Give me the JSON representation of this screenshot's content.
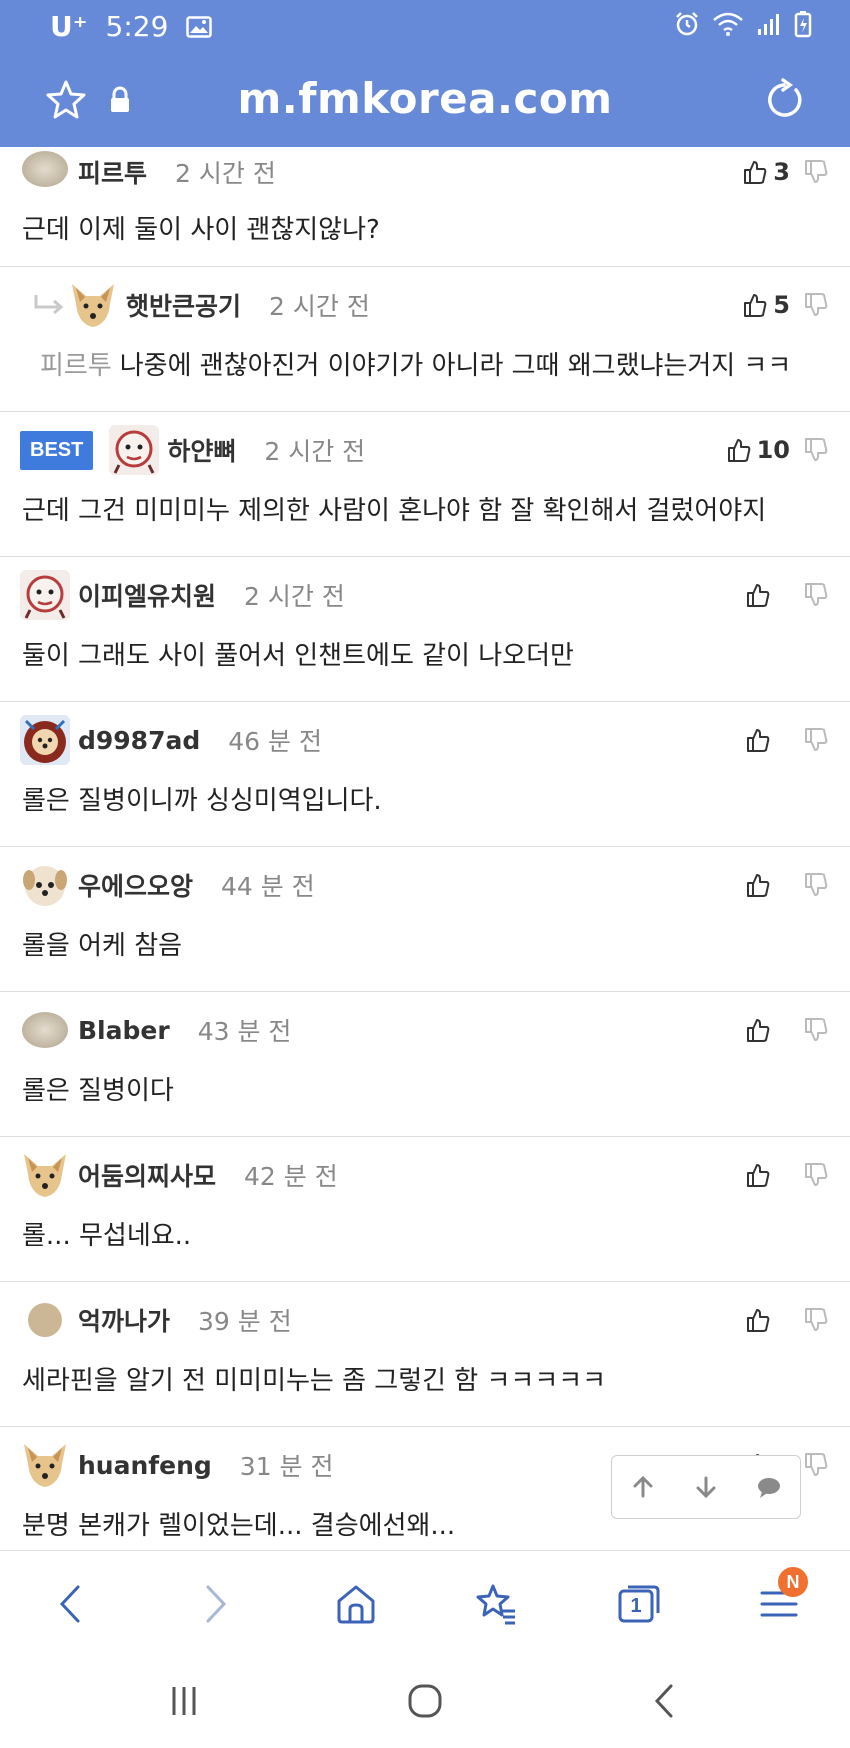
{
  "status_bar": {
    "carrier": "U⁺",
    "time": "5:29",
    "icons": [
      "image-icon",
      "alarm-icon",
      "wifi-icon",
      "signal-icon",
      "battery-icon"
    ]
  },
  "address_bar": {
    "url": "m.fmkorea.com",
    "icons": [
      "star-icon",
      "lock-icon",
      "reload-icon"
    ]
  },
  "colors": {
    "header_bg": "#6689d8",
    "best_badge": "#3f7bdd",
    "notification_badge": "#f07030"
  },
  "comments": [
    {
      "author": "피르투",
      "time": "2 시간 전",
      "up": "3",
      "text": "근데 이제 둘이 사이 괜찮지않나?",
      "avatar": "avatar-blur"
    },
    {
      "author": "햇반큰공기",
      "time": "2 시간 전",
      "up": "5",
      "reply_to": "피르투",
      "text": "나중에 괜찮아진거 이야기가 아니라 그때 왜그랬냐는거지 ㅋㅋ",
      "avatar": "avatar-dog"
    },
    {
      "author": "하얀뼈",
      "time": "2 시간 전",
      "up": "10",
      "badge": "BEST",
      "text": "근데 그건 미미미누 제의한 사람이 혼나야 함 잘 확인해서 걸렀어야지",
      "avatar": "avatar-face"
    },
    {
      "author": "이피엘유치원",
      "time": "2 시간 전",
      "up": "",
      "text": "둘이 그래도 사이 풀어서 인챈트에도 같이 나오더만",
      "avatar": "avatar-face"
    },
    {
      "author": "d9987ad",
      "time": "46 분 전",
      "up": "",
      "text": "롤은 질병이니까 싱싱미역입니다.",
      "avatar": "avatar-lion"
    },
    {
      "author": "우에으오앙",
      "time": "44 분 전",
      "up": "",
      "text": "롤을 어케 참음",
      "avatar": "avatar-puppy"
    },
    {
      "author": "Blaber",
      "time": "43 분 전",
      "up": "",
      "text": "롤은 질병이다",
      "avatar": "avatar-blur"
    },
    {
      "author": "어둠의찌사모",
      "time": "42 분 전",
      "up": "",
      "text": "롤... 무섭네요..",
      "avatar": "avatar-dog"
    },
    {
      "author": "억까나가",
      "time": "39 분 전",
      "up": "",
      "text": "세라핀을 알기 전 미미미누는 좀 그렇긴 함 ㅋㅋㅋㅋㅋ",
      "avatar": "avatar-circle"
    },
    {
      "author": "huanfeng",
      "time": "31 분 전",
      "up": "",
      "text": "분명 본캐가 렐이었는데... 결승에선왜...",
      "avatar": "avatar-dog"
    }
  ],
  "float_nav": [
    "arrow-up-icon",
    "arrow-down-icon",
    "comment-icon"
  ],
  "bottom_bar": {
    "items": [
      "back-icon",
      "forward-icon",
      "home-icon",
      "bookmarks-icon",
      "tabs-icon",
      "menu-icon"
    ],
    "tab_count": "1",
    "menu_badge": "N"
  },
  "system_nav": [
    "recents-icon",
    "home-button-icon",
    "back-nav-icon"
  ]
}
